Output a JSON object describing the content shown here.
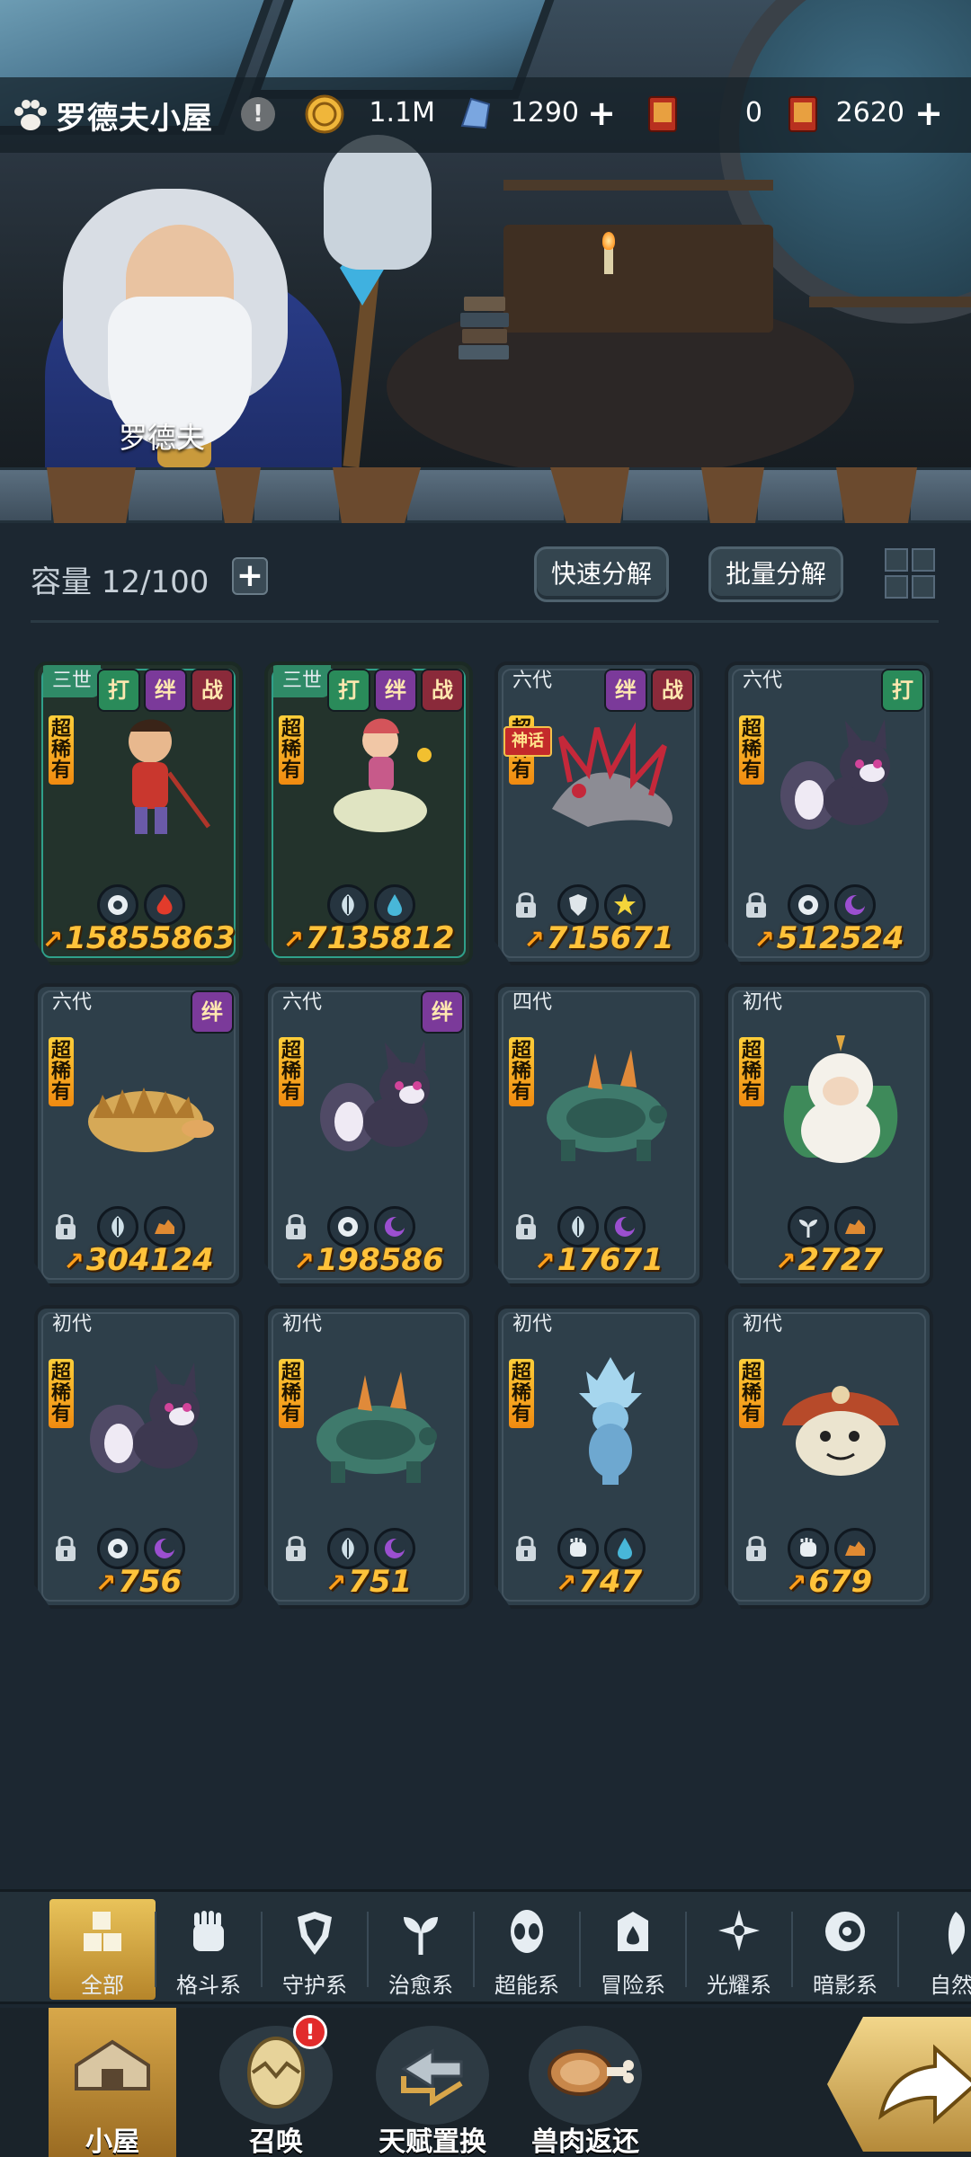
{
  "header": {
    "title": "罗德夫小屋",
    "info_symbol": "!",
    "npc_name": "罗德夫"
  },
  "currencies": [
    {
      "name": "gold-coin-icon",
      "value": "1.1M",
      "has_plus": false
    },
    {
      "name": "crystal-icon",
      "value": "1290",
      "has_plus": true
    },
    {
      "name": "ticket-dai-icon",
      "value": "0",
      "has_plus": false
    },
    {
      "name": "ticket-dian-icon",
      "value": "2620",
      "has_plus": true
    }
  ],
  "capacity": {
    "label": "容量 12/100",
    "add_symbol": "+"
  },
  "actions": {
    "quick_decompose": "快速分解",
    "batch_decompose": "批量分解"
  },
  "rarity_text": "超稀有",
  "cards": [
    {
      "gen": "三世",
      "tags": [
        "打",
        "绊",
        "战"
      ],
      "power": "15855863",
      "locked": false,
      "attrs": [
        "eye-icon",
        "fire-icon"
      ],
      "creature": "warrior-boy",
      "gold": true
    },
    {
      "gen": "三世",
      "tags": [
        "打",
        "绊",
        "战"
      ],
      "power": "7135812",
      "locked": false,
      "attrs": [
        "leaf-icon",
        "drop-icon"
      ],
      "creature": "cloud-girl",
      "gold": true
    },
    {
      "gen": "六代",
      "tags": [
        "绊",
        "战"
      ],
      "power": "715671",
      "locked": true,
      "attrs": [
        "shield-icon",
        "star-icon"
      ],
      "creature": "spiky-dragon",
      "gold": false,
      "mythic": "神话"
    },
    {
      "gen": "六代",
      "tags": [
        "打"
      ],
      "power": "512524",
      "locked": true,
      "attrs": [
        "eye-icon",
        "moon-icon"
      ],
      "creature": "shadow-fox",
      "gold": false
    },
    {
      "gen": "六代",
      "tags": [
        "绊"
      ],
      "power": "304124",
      "locked": true,
      "attrs": [
        "leaf-icon",
        "rock-icon"
      ],
      "creature": "platypus",
      "gold": false
    },
    {
      "gen": "六代",
      "tags": [
        "绊"
      ],
      "power": "198586",
      "locked": true,
      "attrs": [
        "eye-icon",
        "moon-icon"
      ],
      "creature": "shadow-fox",
      "gold": false
    },
    {
      "gen": "四代",
      "tags": [],
      "power": "17671",
      "locked": true,
      "attrs": [
        "leaf-icon",
        "moon-icon"
      ],
      "creature": "horned-beast",
      "gold": false
    },
    {
      "gen": "初代",
      "tags": [],
      "power": "2727",
      "locked": false,
      "attrs": [
        "sprout-icon",
        "rock-icon"
      ],
      "creature": "white-sage",
      "gold": false
    },
    {
      "gen": "初代",
      "tags": [],
      "power": "756",
      "locked": true,
      "attrs": [
        "eye-icon",
        "moon-icon"
      ],
      "creature": "shadow-fox",
      "gold": false
    },
    {
      "gen": "初代",
      "tags": [],
      "power": "751",
      "locked": true,
      "attrs": [
        "leaf-icon",
        "moon-icon"
      ],
      "creature": "horned-beast",
      "gold": false
    },
    {
      "gen": "初代",
      "tags": [],
      "power": "747",
      "locked": true,
      "attrs": [
        "fist-icon",
        "drop-icon"
      ],
      "creature": "ice-spirit",
      "gold": false
    },
    {
      "gen": "初代",
      "tags": [],
      "power": "679",
      "locked": true,
      "attrs": [
        "fist-icon",
        "rock-icon"
      ],
      "creature": "mushroom-blob",
      "gold": false
    }
  ],
  "categories": [
    {
      "label": "全部",
      "icon": "all-icon",
      "active": true
    },
    {
      "label": "格斗系",
      "icon": "fist-icon",
      "active": false
    },
    {
      "label": "守护系",
      "icon": "shield-icon",
      "active": false
    },
    {
      "label": "治愈系",
      "icon": "sprout-icon",
      "active": false
    },
    {
      "label": "超能系",
      "icon": "alien-icon",
      "active": false
    },
    {
      "label": "冒险系",
      "icon": "adventure-icon",
      "active": false
    },
    {
      "label": "光耀系",
      "icon": "light-icon",
      "active": false
    },
    {
      "label": "暗影系",
      "icon": "shadow-icon",
      "active": false
    },
    {
      "label": "自然",
      "icon": "nature-icon",
      "active": false
    }
  ],
  "nav": [
    {
      "label": "小屋",
      "icon": "house-icon",
      "active": true,
      "badge": ""
    },
    {
      "label": "召唤",
      "icon": "egg-icon",
      "active": false,
      "badge": "!"
    },
    {
      "label": "天赋置换",
      "icon": "swap-icon",
      "active": false,
      "badge": ""
    },
    {
      "label": "兽肉返还",
      "icon": "meat-icon",
      "active": false,
      "badge": ""
    }
  ],
  "colors": {
    "accent_gold": "#ffc23a",
    "background": "#1c2731",
    "rarity_orange": "#f08a10"
  }
}
